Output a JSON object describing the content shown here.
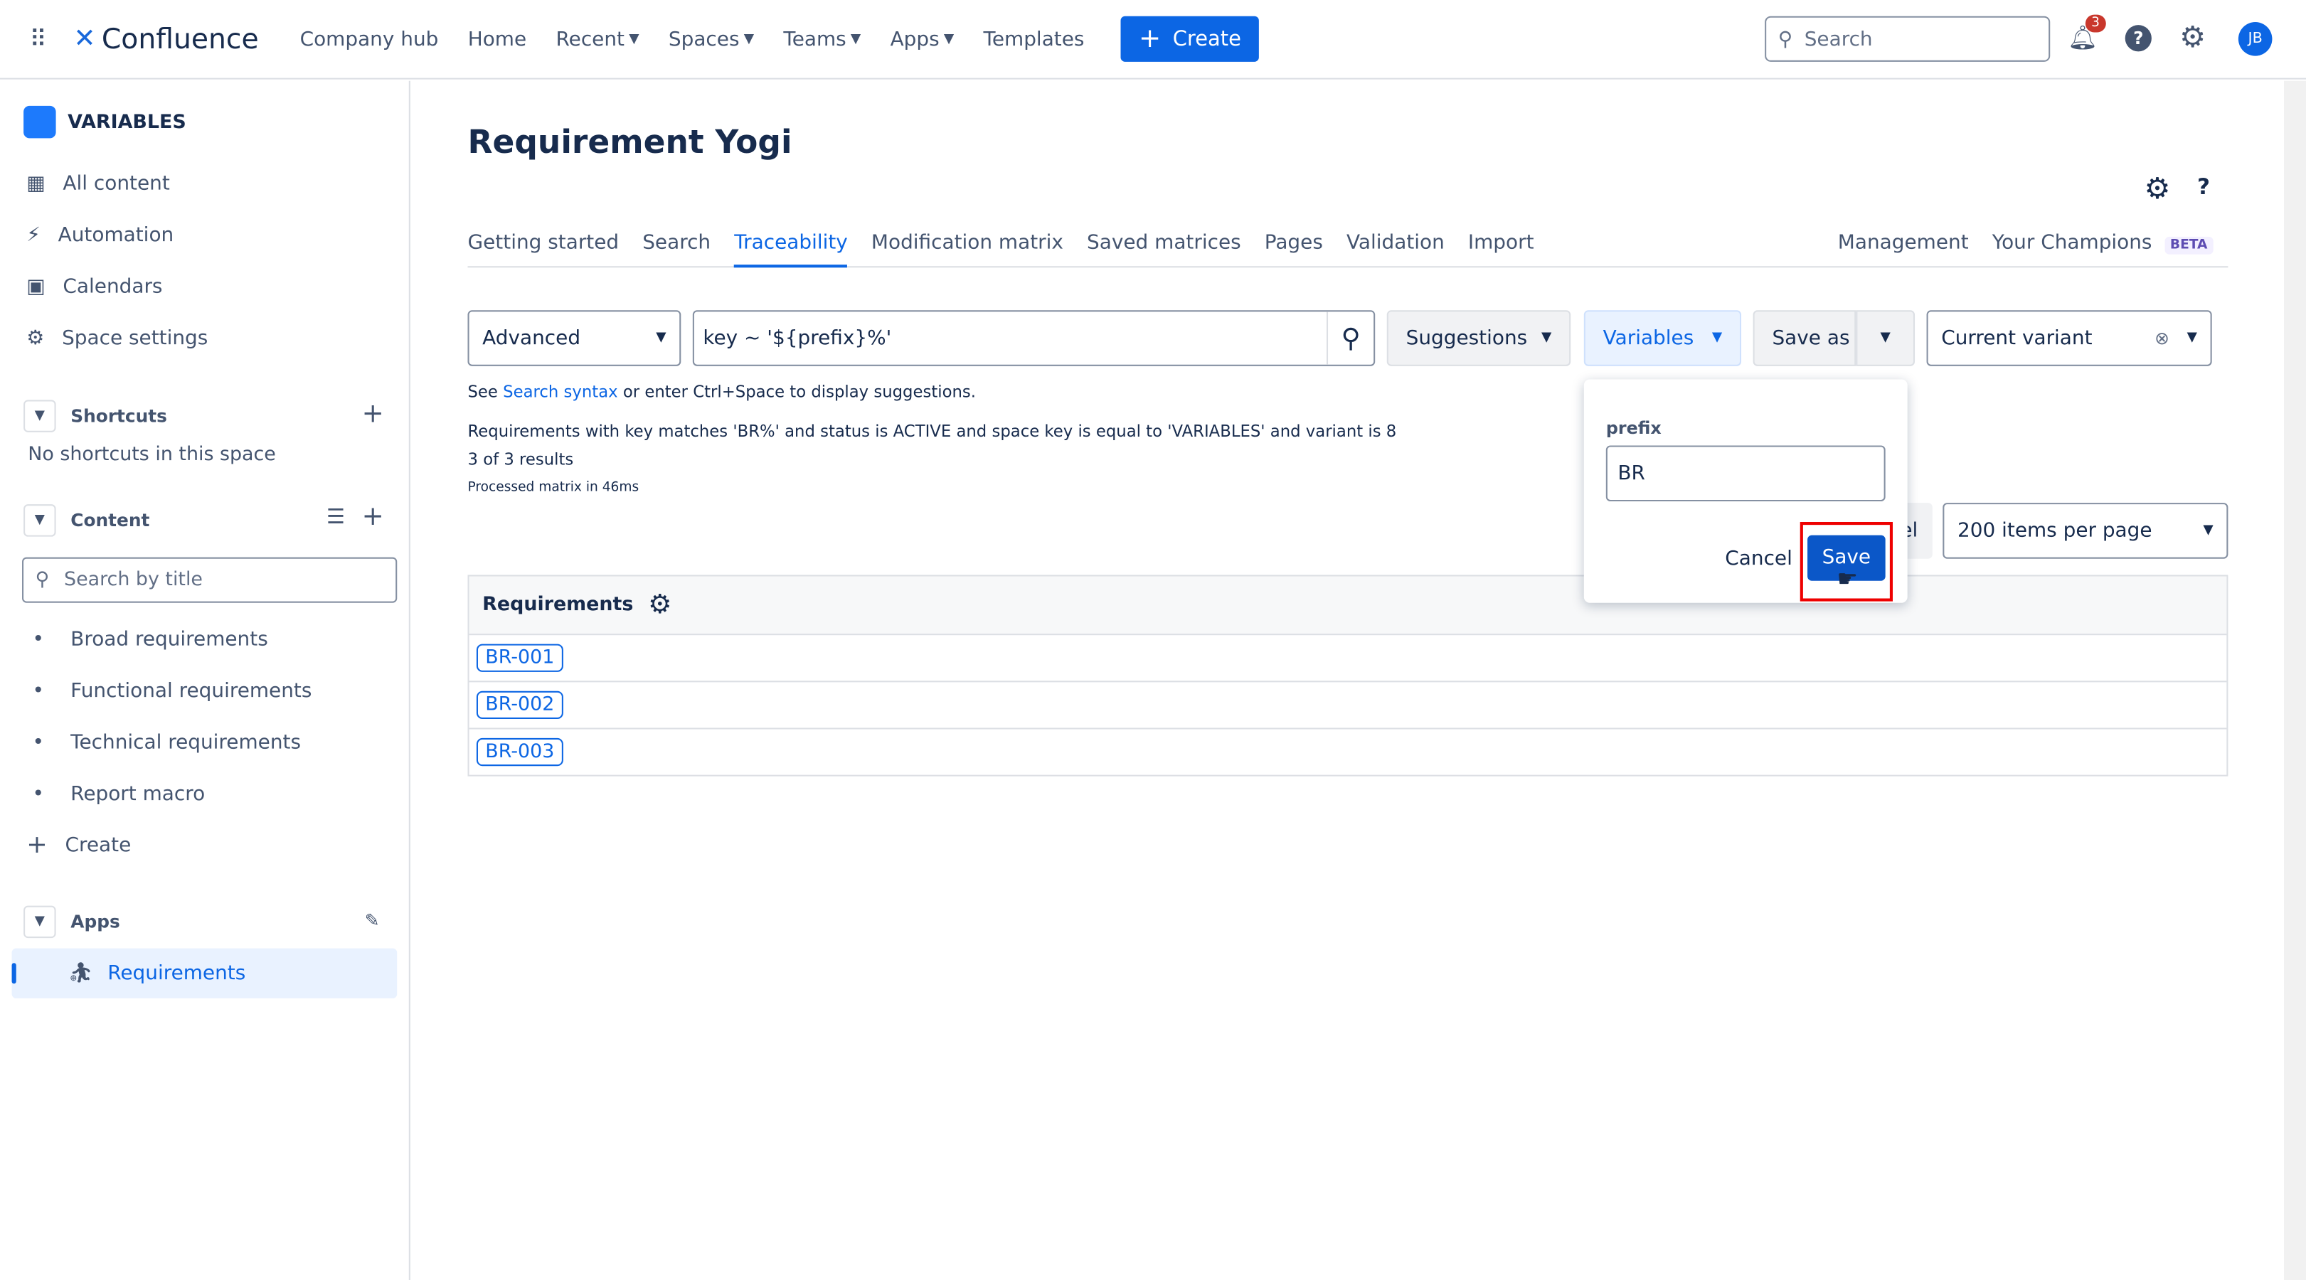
{
  "topbar": {
    "brand": "Confluence",
    "nav": [
      {
        "label": "Company hub",
        "dropdown": false
      },
      {
        "label": "Home",
        "dropdown": false
      },
      {
        "label": "Recent",
        "dropdown": true
      },
      {
        "label": "Spaces",
        "dropdown": true
      },
      {
        "label": "Teams",
        "dropdown": true
      },
      {
        "label": "Apps",
        "dropdown": true
      },
      {
        "label": "Templates",
        "dropdown": false
      }
    ],
    "create_label": "Create",
    "search_placeholder": "Search",
    "notification_count": "3",
    "avatar_initials": "JB",
    "accent": "#0c66e4"
  },
  "sidebar": {
    "space_name": "VARIABLES",
    "items": [
      {
        "label": "All content",
        "icon": "grid-icon"
      },
      {
        "label": "Automation",
        "icon": "lightning-icon"
      },
      {
        "label": "Calendars",
        "icon": "calendar-icon"
      },
      {
        "label": "Space settings",
        "icon": "gear-icon"
      }
    ],
    "shortcuts": {
      "title": "Shortcuts",
      "empty": "No shortcuts in this space"
    },
    "content": {
      "title": "Content",
      "search_placeholder": "Search by title",
      "pages": [
        "Broad requirements",
        "Functional requirements",
        "Technical requirements",
        "Report macro"
      ],
      "create_label": "Create"
    },
    "apps": {
      "title": "Apps",
      "items": [
        {
          "label": "Requirements",
          "selected": true
        }
      ]
    }
  },
  "main": {
    "title": "Requirement Yogi",
    "tabs": [
      "Getting started",
      "Search",
      "Traceability",
      "Modification matrix",
      "Saved matrices",
      "Pages",
      "Validation",
      "Import"
    ],
    "active_tab": "Traceability",
    "right_tabs": {
      "management": "Management",
      "champions": "Your Champions",
      "beta": "BETA"
    },
    "toolbar": {
      "mode": "Advanced",
      "query": "key ~ '${prefix}%'",
      "suggestions": "Suggestions",
      "variables": "Variables",
      "save_as": "Save as",
      "variant": "Current variant"
    },
    "hint": {
      "prefix": "See",
      "link": "Search syntax",
      "suffix": "or enter Ctrl+Space to display suggestions."
    },
    "description": "Requirements with key matches 'BR%' and status is ACTIVE and space key is equal to 'VARIABLES' and variant is 8",
    "results": "3 of 3 results",
    "processed": "Processed matrix in 46ms",
    "hidden_button_fragment": "el",
    "per_page": "200 items per page",
    "table": {
      "header": "Requirements",
      "rows": [
        "BR-001",
        "BR-002",
        "BR-003"
      ]
    }
  },
  "popup": {
    "label": "prefix",
    "value": "BR",
    "cancel": "Cancel",
    "save": "Save"
  }
}
